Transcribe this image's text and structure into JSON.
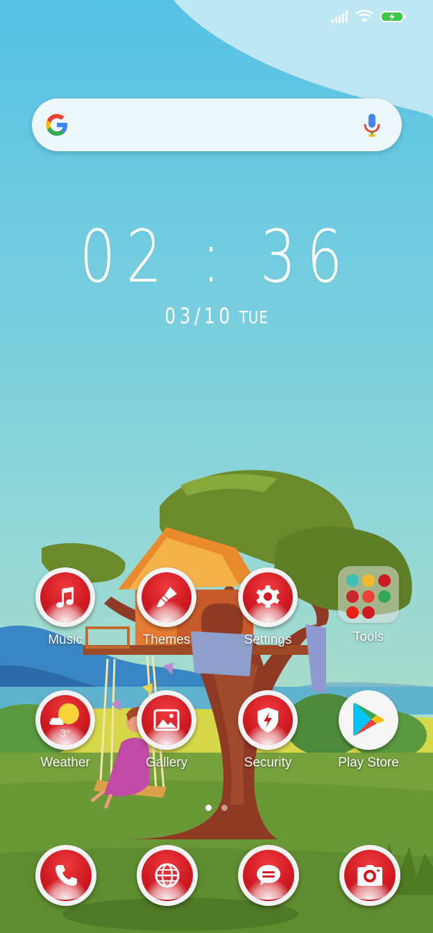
{
  "status_bar": {
    "signal_icon": "signal-bars-icon",
    "wifi_icon": "wifi-icon",
    "battery_icon": "battery-charging-icon"
  },
  "search": {
    "logo": "google-g-icon",
    "mic": "microphone-icon"
  },
  "clock": {
    "time": "02 : 36",
    "date": "03/10",
    "day": "TUE"
  },
  "apps": [
    {
      "label": "Music",
      "icon": "music-note-icon"
    },
    {
      "label": "Themes",
      "icon": "paintbrush-icon"
    },
    {
      "label": "Settings",
      "icon": "gear-icon"
    },
    {
      "label": "Tools",
      "icon": "folder-icon"
    },
    {
      "label": "Weather",
      "icon": "weather-sun-cloud-icon",
      "temperature": "3°"
    },
    {
      "label": "Gallery",
      "icon": "image-icon"
    },
    {
      "label": "Security",
      "icon": "shield-bolt-icon"
    },
    {
      "label": "Play Store",
      "icon": "play-store-icon"
    }
  ],
  "dock": [
    {
      "name": "phone",
      "icon": "phone-icon"
    },
    {
      "name": "browser",
      "icon": "globe-icon"
    },
    {
      "name": "messages",
      "icon": "message-bubble-icon"
    },
    {
      "name": "camera",
      "icon": "camera-icon"
    }
  ],
  "pager": {
    "pages": 2,
    "current": 1
  },
  "colors": {
    "sky": "#5cc6e4",
    "icon_red": "#d01a22",
    "grass": "#6c9a3a",
    "tree_trunk": "#8e3a25",
    "foliage": "#6b8a2c"
  }
}
